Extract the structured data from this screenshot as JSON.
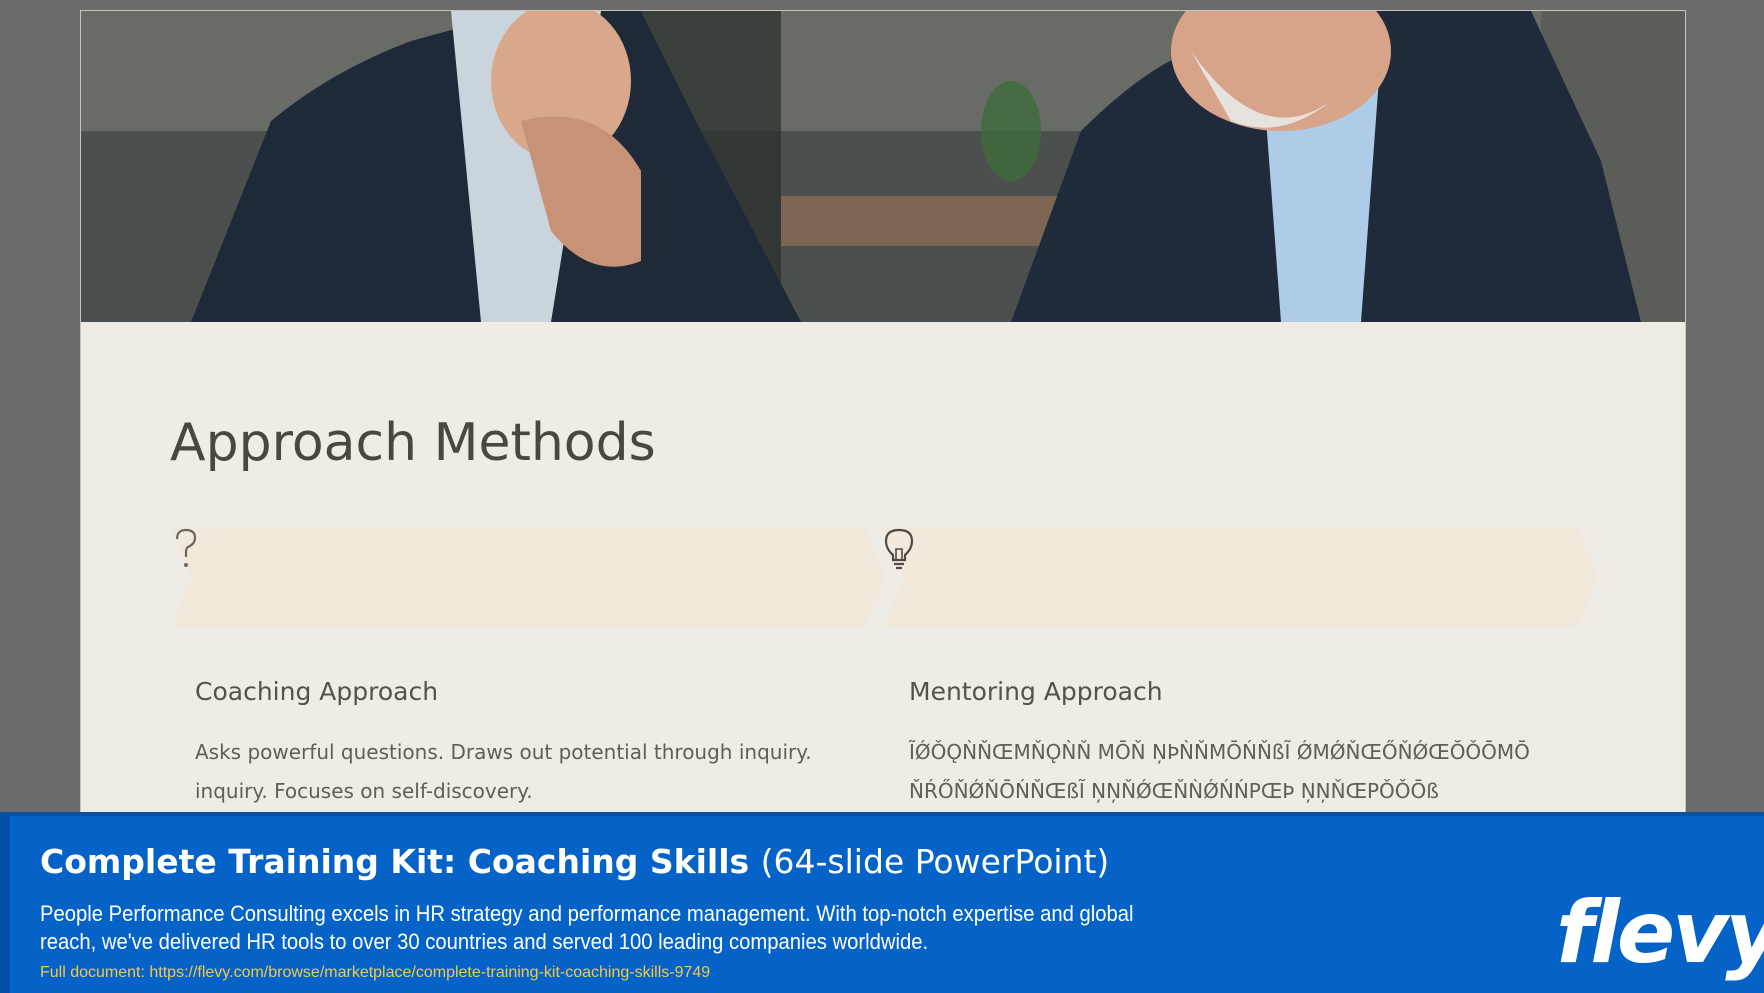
{
  "slide": {
    "photo": {
      "icon": "business-meeting-photo"
    },
    "title": "Approach Methods",
    "columns": [
      {
        "icon": "question-mark-icon",
        "heading": "Coaching Approach",
        "body": "Asks powerful questions. Draws out potential through inquiry. inquiry. Focuses on self-discovery."
      },
      {
        "icon": "lightbulb-icon",
        "heading": "Mentoring Approach",
        "body": "ĨǾǑǪǸŇŒMŇǪǸŇ MŌŇ ŅÞǸŇMŌŃŇßĨ ǾMǾŇŒŐŇǾŒŎǑŌMŌ ŇŔŐŇǾŇŌŃŇŒßĨ ŅŅŇǾŒŇǸǾŃŃPŒÞ ŅŅŇŒPǑǑŌß"
      }
    ],
    "colors": {
      "background": "#efebe5",
      "chevron_fill": "#f2e9dd",
      "title_text": "#4a4740"
    }
  },
  "banner": {
    "title_bold": "Complete Training Kit: Coaching Skills",
    "title_light": "(64-slide PowerPoint)",
    "description": "People Performance Consulting excels in HR strategy and performance management. With top-notch expertise and global reach, we've delivered HR tools to over 30 countries and served 100 leading companies worldwide.",
    "link_label": "Full document: https://flevy.com/browse/marketplace/complete-training-kit-coaching-skills-9749",
    "logo_text": "flevy",
    "colors": {
      "background": "#0563c8",
      "link": "#f2c94c"
    }
  }
}
